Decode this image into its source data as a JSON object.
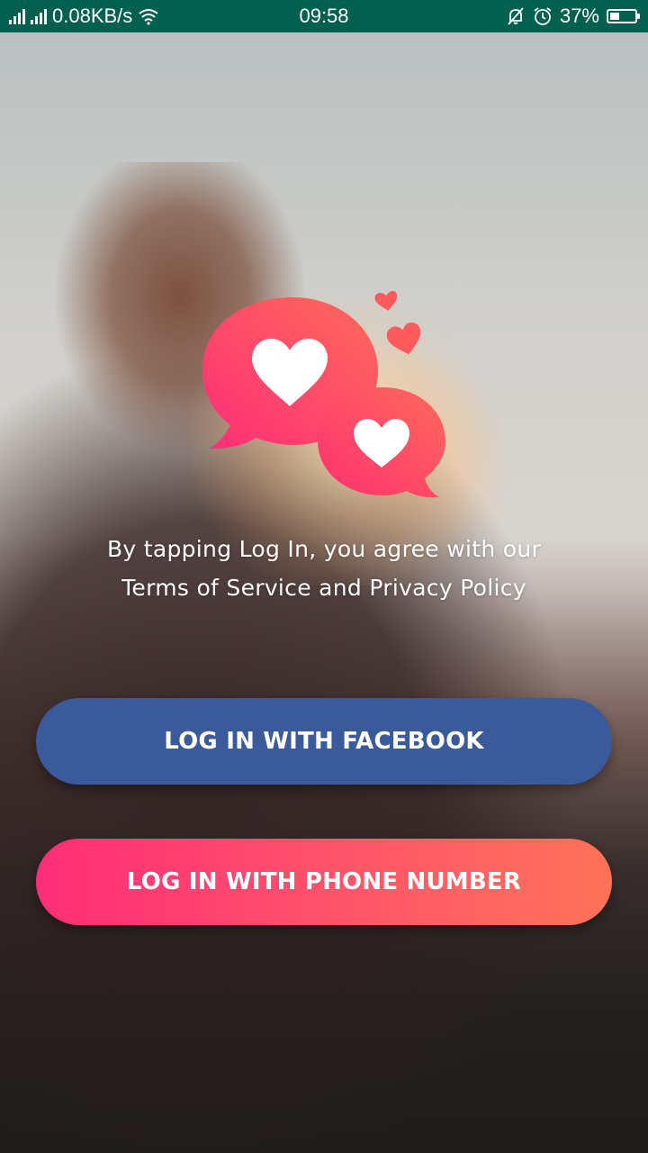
{
  "status_bar": {
    "network_speed": "0.08KB/s",
    "time": "09:58",
    "battery_percent": "37%",
    "battery_level": 0.37,
    "icons": [
      "signal-icon",
      "signal-icon",
      "wifi-icon",
      "bell-off-icon",
      "alarm-icon",
      "battery-icon"
    ]
  },
  "logo": {
    "icon": "heart-chat-bubbles-logo",
    "colors": {
      "gradient_start": "#ff2d78",
      "gradient_end": "#ff6b5a"
    }
  },
  "terms_text": "By tapping Log In, you agree with our Terms of Service and Privacy Policy",
  "buttons": {
    "facebook_label": "LOG IN WITH FACEBOOK",
    "phone_label": "LOG IN WITH PHONE NUMBER"
  },
  "colors": {
    "status_bar": "#03604f",
    "facebook": "#3b5a9b",
    "phone_gradient_start": "#ff2d78",
    "phone_gradient_end": "#ff7258"
  }
}
